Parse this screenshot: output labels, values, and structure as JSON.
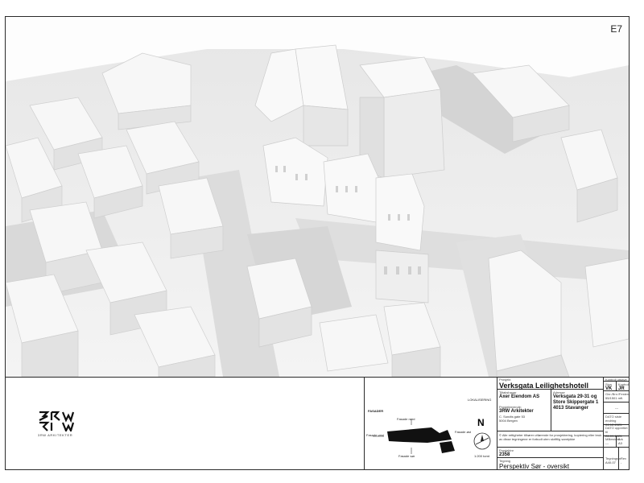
{
  "sheet_code": "E7",
  "logo": {
    "text": "3RW",
    "sub": "3RW ARKITEKTER"
  },
  "keymap": {
    "heading": "FASADER",
    "north_heading": "LOKALISERING",
    "north_letter": "N",
    "scale_note": "1:200 tomt",
    "view_labels": [
      "Fasade nord",
      "Fasade vest",
      "Fasade øst",
      "Fasade sør"
    ]
  },
  "project": {
    "label": "Prosjekt",
    "name": "Verksgata Leilighetshotell",
    "client_label": "Tiltakshaver",
    "client": "Axer Eiendom AS",
    "address_label": "Adresse",
    "address_lines": [
      "Verksgata 29-31 og",
      "Store Skippergate 1",
      "4013 Stavanger"
    ],
    "designer_label": "Prosjekterende:",
    "designer_name": "3RW Arkitekter",
    "designer_lines": [
      "C. Sundts gate 53",
      "5004 Bergen"
    ],
    "disclaimer": "© Alle rettigheter tilhører utførende for prosjektering, kopiering eller bruk av disse tegningene er forbudt uten skriftlig samtykke",
    "number_label": "Prosjektnr",
    "number": "2358",
    "drawing_label": "Tegning",
    "drawing_title": "Perspektiv Sør - oversikt"
  },
  "control": {
    "heading": "Kontroll utgave",
    "sign_label": "Sign",
    "sign": "VK",
    "check_label": "Kontroll",
    "check": "JR",
    "gnr_label": "Gnr./Bnr./Festenr.",
    "gnr": "55/1501 mfl.",
    "dash": "---",
    "date_change_label": "DATO siste endring",
    "date_change": "04-12-2025",
    "date_created_label": "DATO opprettet til",
    "date_created": "26-09-2025",
    "scale_label": "Målestokk",
    "scale": "---",
    "paper_label": "Ark",
    "paper": "A3",
    "drawing_no_label": "Tegningsnr",
    "drawing_no": "A40-07",
    "rev_label": "Rev",
    "rev": "-"
  }
}
